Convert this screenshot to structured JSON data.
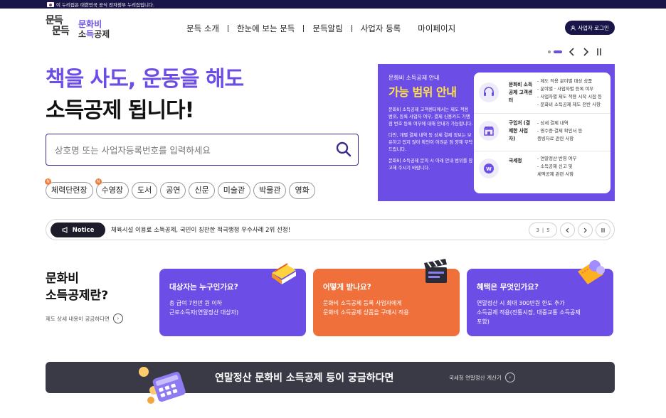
{
  "gov_bar": {
    "text": "이 누리집은 대한민국 공식 전자정부 누리집입니다."
  },
  "logo": {
    "mark_line1": "문득",
    "mark_line2": "문득",
    "text_line1": "문화비",
    "text_line2_a": "소",
    "text_line2_b": "득",
    "text_line2_c": "공제"
  },
  "nav": {
    "items": [
      "문득 소개",
      "한눈에 보는 문득",
      "문득알림",
      "사업자 등록",
      "마이페이지"
    ]
  },
  "login_button": "사업자 로그인",
  "hero": {
    "line1": "책을 사도, 운동을 해도",
    "line2": "소득공제 됩니다!"
  },
  "search": {
    "placeholder": "상호명 또는 사업자등록번호를 입력하세요"
  },
  "tags": [
    {
      "label": "체력단련장",
      "new": true
    },
    {
      "label": "수영장",
      "new": true
    },
    {
      "label": "도서",
      "new": false
    },
    {
      "label": "공연",
      "new": false
    },
    {
      "label": "신문",
      "new": false
    },
    {
      "label": "미술관",
      "new": false
    },
    {
      "label": "박물관",
      "new": false
    },
    {
      "label": "영화",
      "new": false
    }
  ],
  "new_badge": "N",
  "info_panel": {
    "subtitle": "문화비 소득공제 안내",
    "title": "가능 범위 안내",
    "desc1": "문화비 소득공제 고객센터에서는 제도 적용 범위, 등록 사업자 여부, 결제 신용카드 가맹점 번호 등록 여부에 대해 안내가 가능합니다.",
    "desc2": "다만, 개별 결제 내역 등 상세 결제 정보는 보유하고 있지 않아 확인이 어려운 점 양해 부탁드립니다.",
    "desc3": "문화비 소득공제 문의 시 아래 안내 범위를 참고해 주시기 바랍니다.",
    "rows": [
      {
        "label": "문화비 소득공제 고객센터",
        "items": [
          "- 제도 적용 분야별 대상 상품",
          "- 분야별 · 사업자별 등록 여부",
          "- 사업자별 제도 적용 시작 시점 등",
          "- 문화비 소득공제 제도 전반 사항"
        ]
      },
      {
        "label": "구입처 (결제한 사업자)",
        "items": [
          "- 상세 결제 내역",
          "- 영수증·결제 확인서 등",
          "  증빙자료 관련 사항"
        ]
      },
      {
        "label": "국세청",
        "items": [
          "- 연말정산 반영 여부",
          "- 소득공제 신고 및",
          "  세액공제 관련 사항"
        ]
      }
    ]
  },
  "notice": {
    "badge": "Notice",
    "text": "체육시설 이용료 소득공제, 국민이 칭찬한 적극행정 우수사례 2위 선정!",
    "page_current": "3",
    "page_total": "5"
  },
  "about": {
    "title_line1": "문화비",
    "title_line2": "소득공제란?",
    "more": "제도 상세 내용이 궁금하다면"
  },
  "cards": [
    {
      "title": "대상자는 누구인가요?",
      "line1": "총 급여 7천만 원 이하",
      "line2": "근로소득자(연말정산 대상자)",
      "line3": ""
    },
    {
      "title": "어떻게 받나요?",
      "line1": "문화비 소득공제 등록 사업자에게",
      "line2": "문화비 소득공제 상품을 구매시 적용",
      "line3": ""
    },
    {
      "title": "혜택은 무엇인가요?",
      "line1": "연말정산 시 최대 300만원 한도 추가",
      "line2": "소득공제 적용(전통시장, 대중교통 소득공제",
      "line3": "포함)"
    }
  ],
  "banner": {
    "title": "연말정산 문화비 소득공제 등이 궁금하다면",
    "link": "국세청 연말정산 계산기"
  },
  "colors": {
    "primary": "#6c4de6",
    "orange": "#f0703c",
    "navy": "#1a1548",
    "yellow": "#ffe24a"
  }
}
